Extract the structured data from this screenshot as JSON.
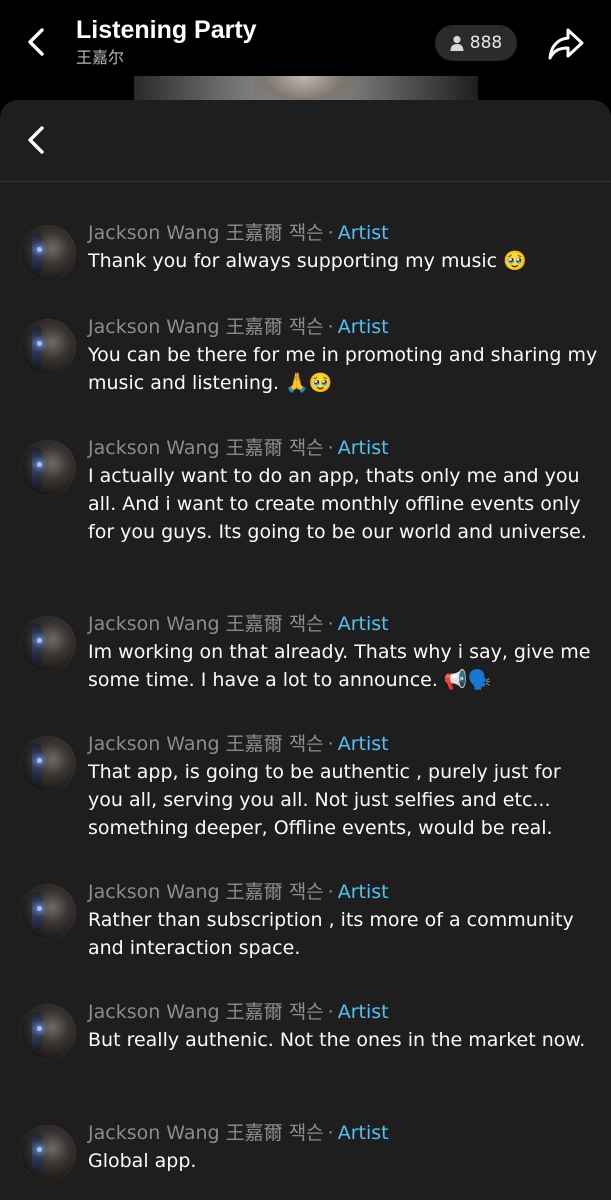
{
  "header": {
    "title": "Listening Party",
    "subtitle": "王嘉尔",
    "listener_count": "888"
  },
  "colors": {
    "background": "#000000",
    "sheet": "#1e1e1e",
    "role_accent": "#4fc3f7",
    "name_text": "#8c8c8c"
  },
  "icons": {
    "back": "chevron-left-icon",
    "person": "person-icon",
    "share": "share-arrow-icon"
  },
  "messages": [
    {
      "author": "Jackson Wang 王嘉爾 잭슨",
      "separator": "·",
      "role": "Artist",
      "text": "Thank you for always supporting my music 🥹"
    },
    {
      "author": "Jackson Wang 王嘉爾 잭슨",
      "separator": "·",
      "role": "Artist",
      "text": "You can be there for me in promoting and sharing my music and listening. 🙏🥹"
    },
    {
      "author": "Jackson Wang 王嘉爾 잭슨",
      "separator": "·",
      "role": "Artist",
      "text": "I actually want to do an app, thats only me and you all. And i want to create monthly offline events only for you guys. Its going to be our world and universe."
    },
    {
      "author": "Jackson Wang 王嘉爾 잭슨",
      "separator": "·",
      "role": "Artist",
      "text": "Im working on that already. Thats why i say, give me some time. I have a lot to announce. 📢🗣️"
    },
    {
      "author": "Jackson Wang 王嘉爾 잭슨",
      "separator": "·",
      "role": "Artist",
      "text": "That app, is going to be authentic , purely just for you all, serving you all.  Not just selfies and etc... something deeper, Offline events, would be real."
    },
    {
      "author": "Jackson Wang 王嘉爾 잭슨",
      "separator": "·",
      "role": "Artist",
      "text": "Rather than subscription , its more of a community and interaction space."
    },
    {
      "author": "Jackson Wang 王嘉爾 잭슨",
      "separator": "·",
      "role": "Artist",
      "text": "But really authenic. Not the ones in the market now."
    },
    {
      "author": "Jackson Wang 王嘉爾 잭슨",
      "separator": "·",
      "role": "Artist",
      "text": "Global app."
    }
  ]
}
